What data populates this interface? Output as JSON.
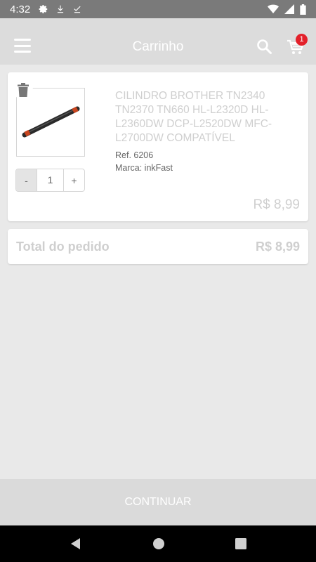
{
  "status_bar": {
    "time": "4:32"
  },
  "app_bar": {
    "title": "Carrinho",
    "cart_count": "1"
  },
  "item": {
    "name": "CILINDRO BROTHER TN2340 TN2370 TN660 HL-L2320D HL-L2360DW DCP-L2520DW MFC-L2700DW COMPATÍVEL",
    "ref": "Ref. 6206",
    "brand": "Marca: inkFast",
    "quantity": "1",
    "minus_label": "-",
    "plus_label": "+",
    "price": "R$ 8,99"
  },
  "total": {
    "label": "Total do pedido",
    "value": "R$ 8,99"
  },
  "continue_label": "CONTINUAR",
  "colors": {
    "app_bar": "#dcdcdc",
    "badge": "#e3202a",
    "status_bar": "#7a7a7a",
    "background": "#e9e9e9"
  }
}
